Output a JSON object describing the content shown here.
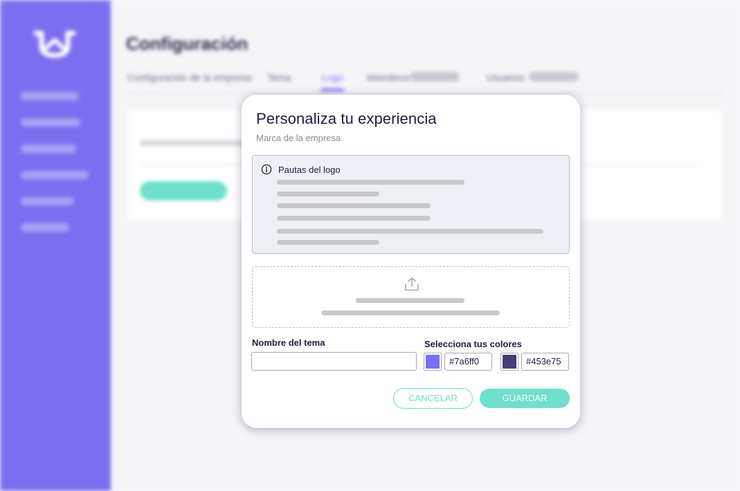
{
  "background": {
    "page_title": "Configuración",
    "tabs": [
      "Configuración de la empresa",
      "Tema",
      "Logo",
      "Miembros",
      "Usuarios"
    ]
  },
  "modal": {
    "title": "Personaliza tu experiencia",
    "subtitle": "Marca de la empresa",
    "info": {
      "icon": "info-icon",
      "title": "Pautas del logo"
    },
    "dropzone": {
      "icon": "upload-icon"
    },
    "theme_name": {
      "label": "Nombre del tema",
      "value": "",
      "placeholder": ""
    },
    "colors": {
      "label": "Selecciona tus colores",
      "primary": "#7a6ff0",
      "secondary": "#453e75"
    },
    "buttons": {
      "cancel": "CANCELAR",
      "save": "GUARDAR"
    }
  },
  "theme": {
    "accent": "#7b6ff0",
    "teal": "#6fe0c9",
    "dark": "#1f1c3f"
  }
}
